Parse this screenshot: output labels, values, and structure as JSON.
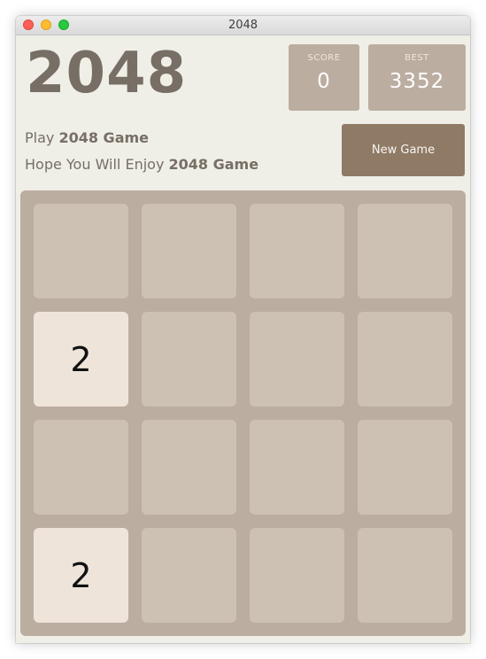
{
  "window": {
    "title": "2048"
  },
  "header": {
    "game_title": "2048",
    "score": {
      "label": "SCORE",
      "value": "0"
    },
    "best": {
      "label": "BEST",
      "value": "3352"
    }
  },
  "intro": {
    "subtitle_prefix": "Play ",
    "subtitle_bold": "2048 Game",
    "tagline_prefix": "Hope You Will Enjoy ",
    "tagline_bold": "2048 Game"
  },
  "controls": {
    "new_game_label": "New Game"
  },
  "board": {
    "rows": [
      [
        "",
        "",
        "",
        ""
      ],
      [
        "2",
        "",
        "",
        ""
      ],
      [
        "",
        "",
        "",
        ""
      ],
      [
        "2",
        "",
        "",
        ""
      ]
    ]
  },
  "colors": {
    "board_background": "#bbada0",
    "empty_cell": "#cdc1b4",
    "tile_2": "#eee4da",
    "button": "#8f7a66",
    "text": "#776e65"
  }
}
